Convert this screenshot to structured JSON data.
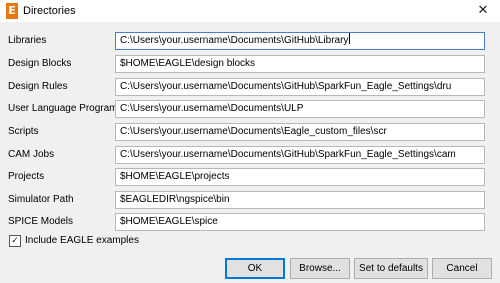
{
  "window": {
    "app_icon_letter": "E",
    "title": "Directories",
    "close_glyph": "✕"
  },
  "rows": [
    {
      "label": "Libraries",
      "value": "C:\\Users\\your.username\\Documents\\GitHub\\Library"
    },
    {
      "label": "Design Blocks",
      "value": "$HOME\\EAGLE\\design blocks"
    },
    {
      "label": "Design Rules",
      "value": "C:\\Users\\your.username\\Documents\\GitHub\\SparkFun_Eagle_Settings\\dru"
    },
    {
      "label": "User Language Programs",
      "value": "C:\\Users\\your.username\\Documents\\ULP"
    },
    {
      "label": "Scripts",
      "value": "C:\\Users\\your.username\\Documents\\Eagle_custom_files\\scr"
    },
    {
      "label": "CAM Jobs",
      "value": "C:\\Users\\your.username\\Documents\\GitHub\\SparkFun_Eagle_Settings\\cam"
    },
    {
      "label": "Projects",
      "value": "$HOME\\EAGLE\\projects"
    },
    {
      "label": "Simulator Path",
      "value": "$EAGLEDIR\\ngspice\\bin"
    },
    {
      "label": "SPICE Models",
      "value": "$HOME\\EAGLE\\spice"
    }
  ],
  "include_examples": {
    "checked": true,
    "check_glyph": "✓",
    "label": "Include EAGLE examples"
  },
  "buttons": {
    "ok": "OK",
    "browse": "Browse...",
    "defaults": "Set to defaults",
    "cancel": "Cancel"
  }
}
